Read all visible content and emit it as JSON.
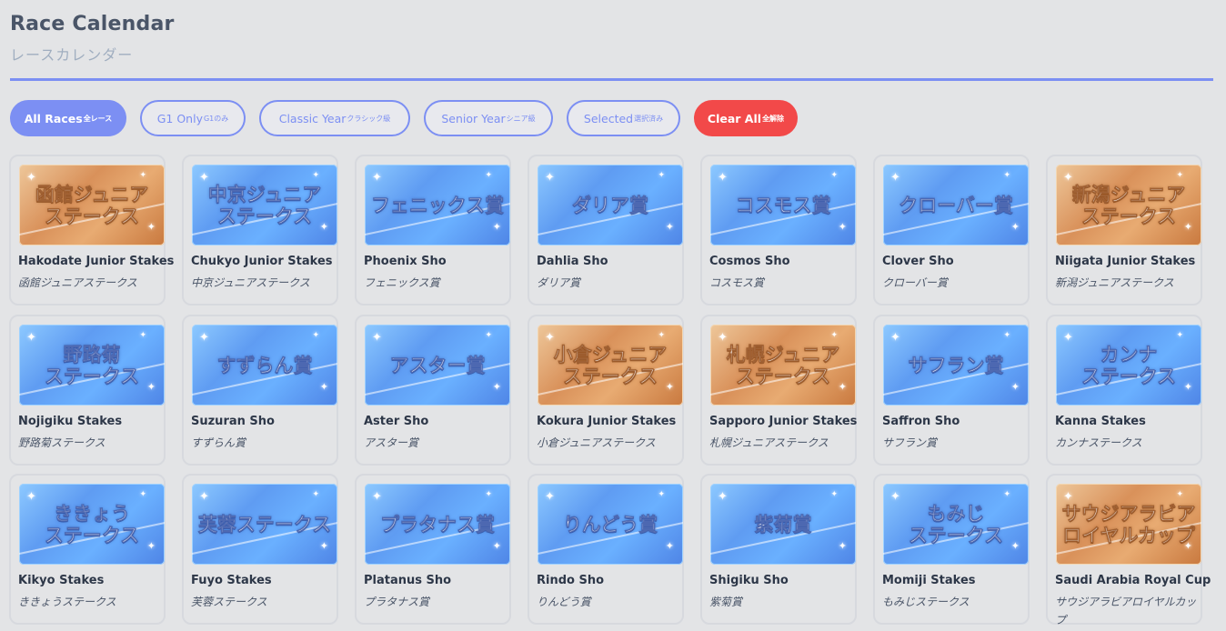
{
  "header": {
    "title": "Race Calendar",
    "subtitle": "レースカレンダー"
  },
  "filters": [
    {
      "label": "All Races",
      "jp": "全レース",
      "style": "active"
    },
    {
      "label": "G1 Only",
      "jp": "G1のみ",
      "style": "outline"
    },
    {
      "label": "Classic Year",
      "jp": "クラシック級",
      "style": "outline"
    },
    {
      "label": "Senior Year",
      "jp": "シニア級",
      "style": "outline"
    },
    {
      "label": "Selected",
      "jp": "選択済み",
      "style": "outline"
    },
    {
      "label": "Clear All",
      "jp": "全解除",
      "style": "danger"
    }
  ],
  "colors": {
    "accent": "#7c8ff3",
    "danger": "#f24949",
    "background": "#e3e4e6"
  },
  "races": [
    {
      "name": "Hakodate Junior Stakes",
      "jp": "函館ジュニアステークス",
      "banner": "函館ジュニア\nステークス",
      "theme": "orange"
    },
    {
      "name": "Chukyo Junior Stakes",
      "jp": "中京ジュニアステークス",
      "banner": "中京ジュニア\nステークス",
      "theme": "blue"
    },
    {
      "name": "Phoenix Sho",
      "jp": "フェニックス賞",
      "banner": "フェニックス賞",
      "theme": "blue"
    },
    {
      "name": "Dahlia Sho",
      "jp": "ダリア賞",
      "banner": "ダリア賞",
      "theme": "blue"
    },
    {
      "name": "Cosmos Sho",
      "jp": "コスモス賞",
      "banner": "コスモス賞",
      "theme": "blue"
    },
    {
      "name": "Clover Sho",
      "jp": "クローバー賞",
      "banner": "クローバー賞",
      "theme": "blue"
    },
    {
      "name": "Niigata Junior Stakes",
      "jp": "新潟ジュニアステークス",
      "banner": "新潟ジュニア\nステークス",
      "theme": "orange"
    },
    {
      "name": "Nojigiku Stakes",
      "jp": "野路菊ステークス",
      "banner": "野路菊\nステークス",
      "theme": "blue"
    },
    {
      "name": "Suzuran Sho",
      "jp": "すずらん賞",
      "banner": "すずらん賞",
      "theme": "blue"
    },
    {
      "name": "Aster Sho",
      "jp": "アスター賞",
      "banner": "アスター賞",
      "theme": "blue"
    },
    {
      "name": "Kokura Junior Stakes",
      "jp": "小倉ジュニアステークス",
      "banner": "小倉ジュニア\nステークス",
      "theme": "orange"
    },
    {
      "name": "Sapporo Junior Stakes",
      "jp": "札幌ジュニアステークス",
      "banner": "札幌ジュニア\nステークス",
      "theme": "orange"
    },
    {
      "name": "Saffron Sho",
      "jp": "サフラン賞",
      "banner": "サフラン賞",
      "theme": "blue"
    },
    {
      "name": "Kanna Stakes",
      "jp": "カンナステークス",
      "banner": "カンナ\nステークス",
      "theme": "blue"
    },
    {
      "name": "Kikyo Stakes",
      "jp": "ききょうステークス",
      "banner": "ききょう\nステークス",
      "theme": "blue"
    },
    {
      "name": "Fuyo Stakes",
      "jp": "芙蓉ステークス",
      "banner": "芙蓉ステークス",
      "theme": "blue"
    },
    {
      "name": "Platanus Sho",
      "jp": "プラタナス賞",
      "banner": "プラタナス賞",
      "theme": "blue"
    },
    {
      "name": "Rindo Sho",
      "jp": "りんどう賞",
      "banner": "りんどう賞",
      "theme": "blue"
    },
    {
      "name": "Shigiku Sho",
      "jp": "紫菊賞",
      "banner": "紫菊賞",
      "theme": "blue"
    },
    {
      "name": "Momiji Stakes",
      "jp": "もみじステークス",
      "banner": "もみじ\nステークス",
      "theme": "blue"
    },
    {
      "name": "Saudi Arabia Royal Cup",
      "jp": "サウジアラビアロイヤルカップ",
      "banner": "サウジアラビア\nロイヤルカップ",
      "theme": "orange"
    }
  ]
}
